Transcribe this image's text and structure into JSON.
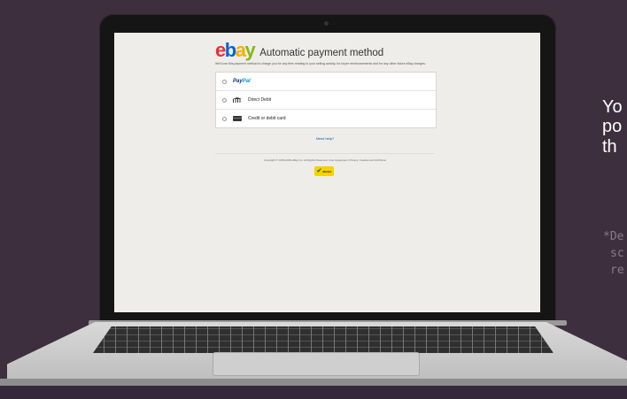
{
  "ebay": {
    "logo": {
      "e": "e",
      "b": "b",
      "a": "a",
      "y": "y"
    },
    "title": "Automatic payment method",
    "description": "We'll use this payment method to charge you for any fees relating to your selling activity, for buyer reimbursements and for any other future eBay charges.",
    "options": [
      {
        "label_pay": "Pay",
        "label_pal": "Pal",
        "icon": "paypal-logo"
      },
      {
        "label": "Direct Debit",
        "icon": "bank-icon"
      },
      {
        "label": "Credit or debit card",
        "icon": "card-icon"
      }
    ],
    "help_link": "Need help?",
    "copyright": "Copyright © 1995-2019 eBay Inc. All Rights Reserved. User Agreement, Privacy, Cookies and AdChoice",
    "norton_label": "Norton"
  },
  "side_text": {
    "line1": "Yo",
    "line2": "po",
    "line3": "th",
    "note1": "*De",
    "note2": "sc",
    "note3": "re"
  },
  "colors": {
    "background": "#3e2f3f",
    "ebay_red": "#e53238",
    "ebay_blue": "#0064d2",
    "ebay_yellow": "#f5af02",
    "ebay_green": "#86b817",
    "link": "#0654ba"
  }
}
